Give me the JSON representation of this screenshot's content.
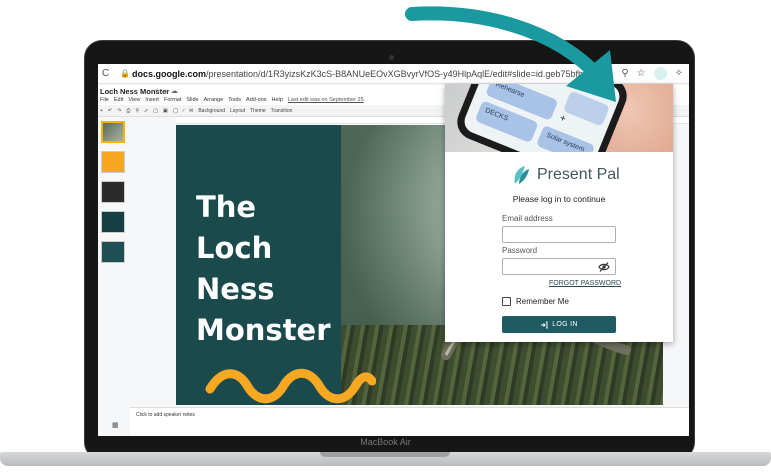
{
  "browser": {
    "url_host": "docs.google.com",
    "url_path": "/presentation/d/1R3yizsKzK3cS-B8ANUeEOvXGBvyrVfOS-y49HlpAqlE/edit#slide=id.geb75bfb851_0_0"
  },
  "doc": {
    "title": "Loch Ness Monster",
    "menus": [
      "File",
      "Edit",
      "View",
      "Insert",
      "Format",
      "Slide",
      "Arrange",
      "Tools",
      "Add-ons",
      "Help"
    ],
    "last_edit": "Last edit was on September 25",
    "toolbar": [
      "Background",
      "Layout",
      "Theme",
      "Transition"
    ],
    "notes_placeholder": "Click to add speaker notes"
  },
  "slide": {
    "title_lines": [
      "The",
      "Loch",
      "Ness",
      "Monster"
    ],
    "left_color": "#1b4a4d",
    "accent_color": "#f7a823"
  },
  "hero": {
    "cards": [
      "Rehearse",
      "DECKS",
      "Solar system"
    ]
  },
  "login": {
    "brand": "Present Pal",
    "subtitle": "Please log in to continue",
    "email_label": "Email address",
    "password_label": "Password",
    "forgot": "FORGOT PASSWORD",
    "remember": "Remember Me",
    "button": "LOG IN",
    "button_color": "#1f5a63"
  },
  "laptop": {
    "model": "MacBook Air"
  },
  "arrow_color": "#1a9aa0"
}
